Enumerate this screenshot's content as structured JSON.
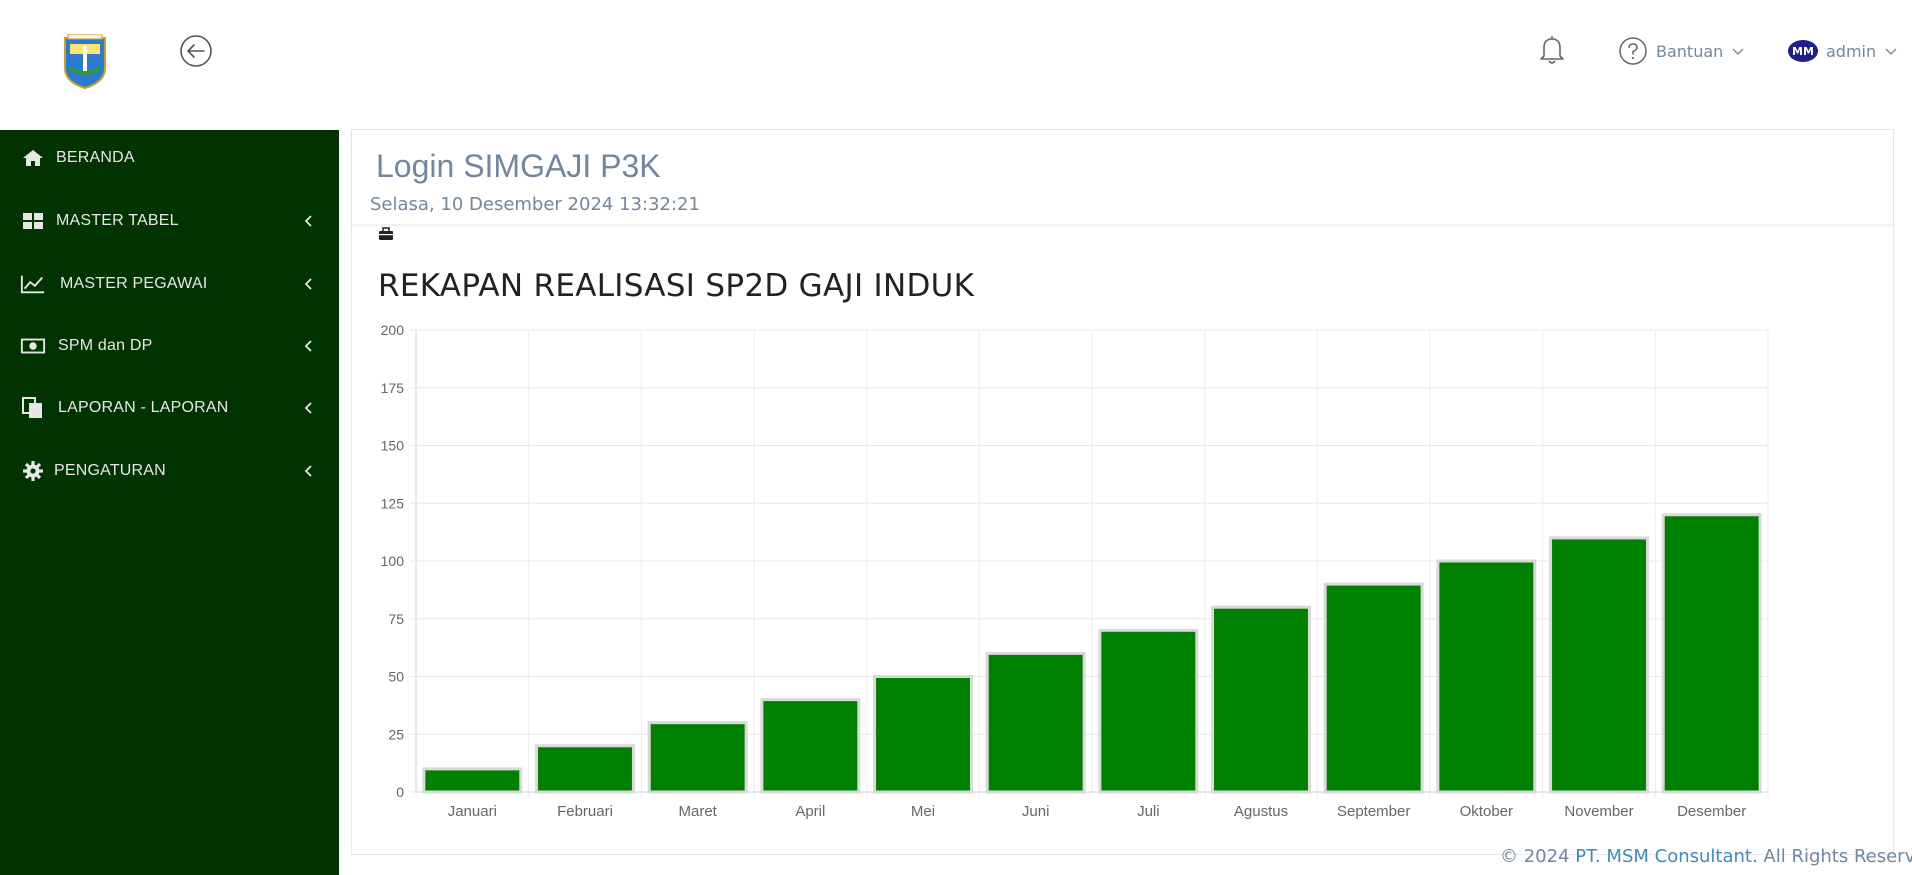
{
  "header": {
    "help_label": "Bantuan",
    "user_label": "admin",
    "avatar_initials": "MM"
  },
  "sidebar": {
    "items": [
      {
        "label": "BERANDA",
        "icon": "home-icon",
        "has_submenu": false
      },
      {
        "label": "MASTER TABEL",
        "icon": "grid-icon",
        "has_submenu": true
      },
      {
        "label": "MASTER PEGAWAI",
        "icon": "line-chart-icon",
        "has_submenu": true
      },
      {
        "label": "SPM dan DP",
        "icon": "money-icon",
        "has_submenu": true
      },
      {
        "label": "LAPORAN - LAPORAN",
        "icon": "documents-icon",
        "has_submenu": true
      },
      {
        "label": "PENGATURAN",
        "icon": "gear-icon",
        "has_submenu": true
      }
    ]
  },
  "page": {
    "title": "Login SIMGAJI P3K",
    "datetime": "Selasa, 10 Desember 2024 13:32:21",
    "chart_heading": "REKAPAN REALISASI SP2D GAJI INDUK"
  },
  "footer": {
    "prefix": "© 2024 ",
    "company": "PT. MSM Consultant.",
    "suffix": " All Rights Reserved"
  },
  "colors": {
    "sidebar_bg": "#003300",
    "bar_fill": "#008000",
    "bar_border": "#d9d9d9",
    "link": "#3c8dbc",
    "muted_text": "#73879c"
  },
  "chart_data": {
    "type": "bar",
    "title": "REKAPAN REALISASI SP2D GAJI INDUK",
    "categories": [
      "Januari",
      "Februari",
      "Maret",
      "April",
      "Mei",
      "Juni",
      "Juli",
      "Agustus",
      "September",
      "Oktober",
      "November",
      "Desember"
    ],
    "values": [
      10,
      20,
      30,
      40,
      50,
      60,
      70,
      80,
      90,
      100,
      110,
      120
    ],
    "ylim": [
      0,
      200
    ],
    "yticks": [
      0,
      25,
      50,
      75,
      100,
      125,
      150,
      175,
      200
    ],
    "grid": true,
    "legend": "none"
  }
}
